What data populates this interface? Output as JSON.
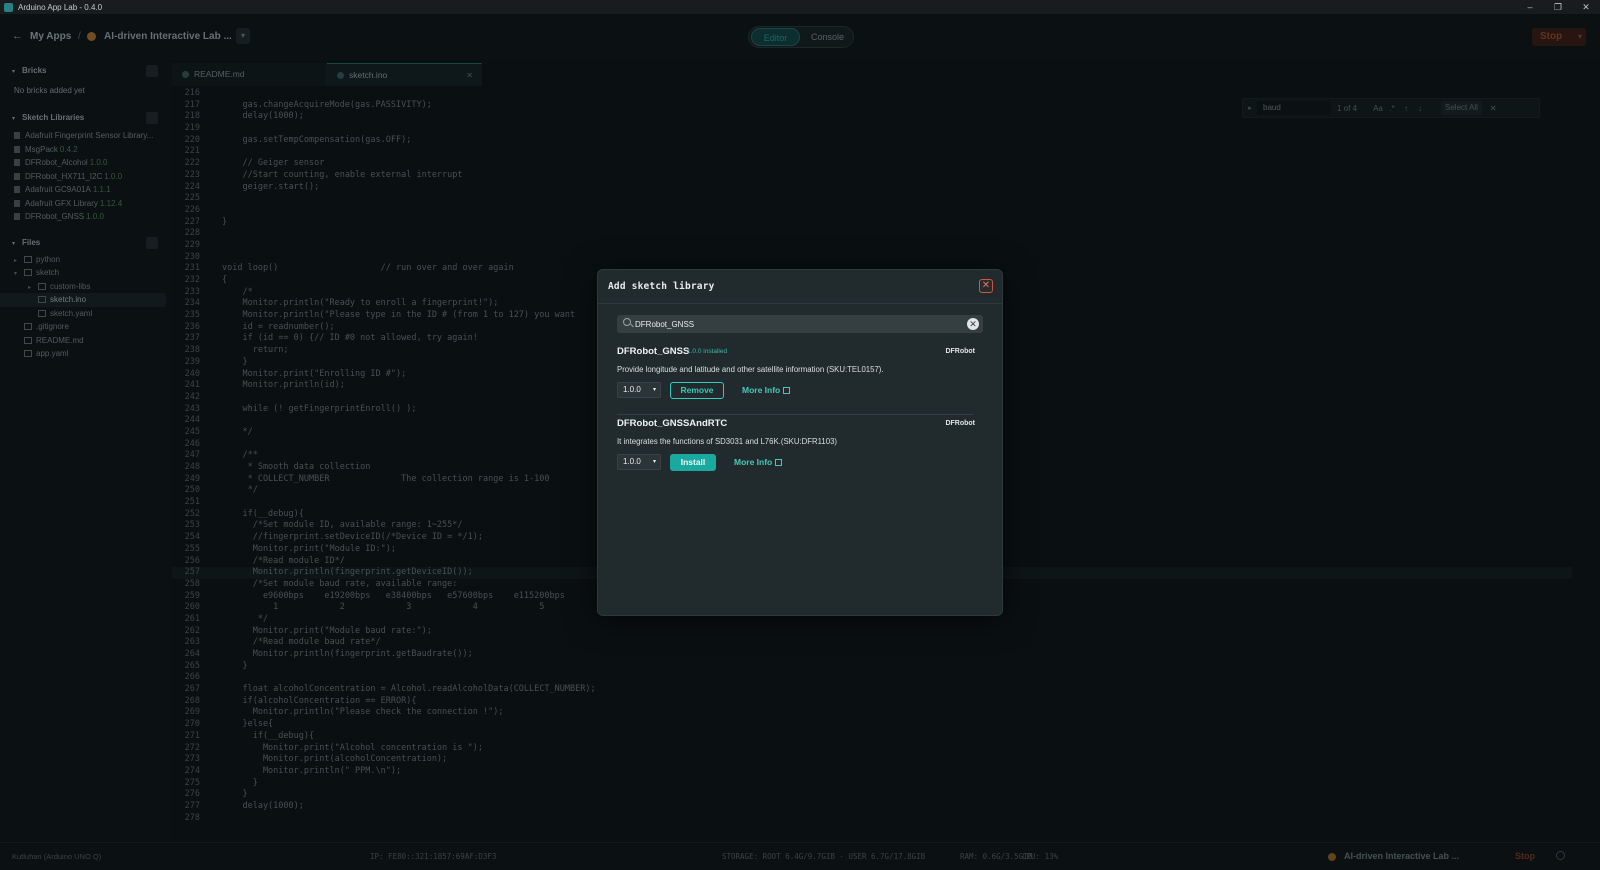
{
  "titlebar": {
    "title": "Arduino App Lab - 0.4.0",
    "minimize": "–",
    "maximize": "❐",
    "close": "✕"
  },
  "topbar": {
    "back": "←",
    "my_apps": "My Apps",
    "separator": "/",
    "app_name": "AI-driven Interactive Lab ...",
    "app_menu": "▾",
    "toggle": {
      "editor": "Editor",
      "console": "Console"
    },
    "stop": "Stop",
    "stop_caret": "▾"
  },
  "sidebar": {
    "bricks": {
      "title": "Bricks",
      "empty": "No bricks added yet"
    },
    "libraries": {
      "title": "Sketch Libraries",
      "items": [
        {
          "name": "Adafruit Fingerprint Sensor Library...",
          "version": ""
        },
        {
          "name": "MsgPack",
          "version": "0.4.2"
        },
        {
          "name": "DFRobot_Alcohol",
          "version": "1.0.0"
        },
        {
          "name": "DFRobot_HX711_I2C",
          "version": "1.0.0"
        },
        {
          "name": "Adafruit GC9A01A",
          "version": "1.1.1"
        },
        {
          "name": "Adafruit GFX Library",
          "version": "1.12.4"
        },
        {
          "name": "DFRobot_GNSS",
          "version": "1.0.0"
        }
      ]
    },
    "files": {
      "title": "Files",
      "items": [
        {
          "name": "python",
          "indent": 0,
          "arrow": "▸",
          "folder": true
        },
        {
          "name": "sketch",
          "indent": 0,
          "arrow": "▾",
          "folder": true
        },
        {
          "name": "custom-libs",
          "indent": 1,
          "arrow": "▸",
          "folder": true
        },
        {
          "name": "sketch.ino",
          "indent": 1,
          "arrow": "",
          "folder": false,
          "selected": true
        },
        {
          "name": "sketch.yaml",
          "indent": 1,
          "arrow": "",
          "folder": false
        },
        {
          "name": ".gitignore",
          "indent": 0,
          "arrow": "",
          "folder": false
        },
        {
          "name": "README.md",
          "indent": 0,
          "arrow": "",
          "folder": false
        },
        {
          "name": "app.yaml",
          "indent": 0,
          "arrow": "",
          "folder": false
        }
      ]
    }
  },
  "tabs": [
    {
      "label": "README.md",
      "active": false,
      "close": ""
    },
    {
      "label": "sketch.ino",
      "active": true,
      "close": "✕"
    }
  ],
  "findbar": {
    "value": "baud",
    "count": "1 of 4",
    "opt_case": "Aa",
    "opt_regex": ".*",
    "up": "↑",
    "down": "↓",
    "select_all": "Select All",
    "close": "✕"
  },
  "code_lines": [
    {
      "n": "216",
      "t": ""
    },
    {
      "n": "217",
      "t": "    gas.changeAcquireMode(gas.PASSIVITY);"
    },
    {
      "n": "218",
      "t": "    delay(1000);"
    },
    {
      "n": "219",
      "t": ""
    },
    {
      "n": "220",
      "t": "    gas.setTempCompensation(gas.OFF);"
    },
    {
      "n": "221",
      "t": ""
    },
    {
      "n": "222",
      "t": "    // Geiger sensor"
    },
    {
      "n": "223",
      "t": "    //Start counting, enable external interrupt"
    },
    {
      "n": "224",
      "t": "    geiger.start();"
    },
    {
      "n": "225",
      "t": ""
    },
    {
      "n": "226",
      "t": ""
    },
    {
      "n": "227",
      "t": "}"
    },
    {
      "n": "228",
      "t": ""
    },
    {
      "n": "229",
      "t": ""
    },
    {
      "n": "230",
      "t": ""
    },
    {
      "n": "231",
      "t": "void loop()                    // run over and over again"
    },
    {
      "n": "232",
      "t": "{"
    },
    {
      "n": "233",
      "t": "    /*"
    },
    {
      "n": "234",
      "t": "    Monitor.println(\"Ready to enroll a fingerprint!\");"
    },
    {
      "n": "235",
      "t": "    Monitor.println(\"Please type in the ID # (from 1 to 127) you want"
    },
    {
      "n": "236",
      "t": "    id = readnumber();"
    },
    {
      "n": "237",
      "t": "    if (id == 0) {// ID #0 not allowed, try again!"
    },
    {
      "n": "238",
      "t": "      return;"
    },
    {
      "n": "239",
      "t": "    }"
    },
    {
      "n": "240",
      "t": "    Monitor.print(\"Enrolling ID #\");"
    },
    {
      "n": "241",
      "t": "    Monitor.println(id);"
    },
    {
      "n": "242",
      "t": ""
    },
    {
      "n": "243",
      "t": "    while (! getFingerprintEnroll() );"
    },
    {
      "n": "244",
      "t": ""
    },
    {
      "n": "245",
      "t": "    */"
    },
    {
      "n": "246",
      "t": ""
    },
    {
      "n": "247",
      "t": "    /**"
    },
    {
      "n": "248",
      "t": "     * Smooth data collection"
    },
    {
      "n": "249",
      "t": "     * COLLECT_NUMBER              The collection range is 1-100"
    },
    {
      "n": "250",
      "t": "     */"
    },
    {
      "n": "251",
      "t": ""
    },
    {
      "n": "252",
      "t": "    if(__debug){"
    },
    {
      "n": "253",
      "t": "      /*Set module ID, available range: 1~255*/"
    },
    {
      "n": "254",
      "t": "      //fingerprint.setDeviceID(/*Device ID = */1);"
    },
    {
      "n": "255",
      "t": "      Monitor.print(\"Module ID:\");"
    },
    {
      "n": "256",
      "t": "      /*Read module ID*/"
    },
    {
      "n": "257",
      "t": "      Monitor.println(fingerprint.getDeviceID());"
    },
    {
      "n": "258",
      "t": "      /*Set module baud rate, available range:"
    },
    {
      "n": "259",
      "t": "        e9600bps    e19200bps   e38400bps   e57600bps    e115200bps"
    },
    {
      "n": "260",
      "t": "          1            2            3            4            5"
    },
    {
      "n": "261",
      "t": "       */"
    },
    {
      "n": "262",
      "t": "      Monitor.print(\"Module baud rate:\");"
    },
    {
      "n": "263",
      "t": "      /*Read module baud rate*/"
    },
    {
      "n": "264",
      "t": "      Monitor.println(fingerprint.getBaudrate());"
    },
    {
      "n": "265",
      "t": "    }"
    },
    {
      "n": "266",
      "t": ""
    },
    {
      "n": "267",
      "t": "    float alcoholConcentration = Alcohol.readAlcoholData(COLLECT_NUMBER);"
    },
    {
      "n": "268",
      "t": "    if(alcoholConcentration == ERROR){"
    },
    {
      "n": "269",
      "t": "      Monitor.println(\"Please check the connection !\");"
    },
    {
      "n": "270",
      "t": "    }else{"
    },
    {
      "n": "271",
      "t": "      if(__debug){"
    },
    {
      "n": "272",
      "t": "        Monitor.print(\"Alcohol concentration is \");"
    },
    {
      "n": "273",
      "t": "        Monitor.print(alcoholConcentration);"
    },
    {
      "n": "274",
      "t": "        Monitor.println(\" PPM.\\n\");"
    },
    {
      "n": "275",
      "t": "      }"
    },
    {
      "n": "276",
      "t": "    }"
    },
    {
      "n": "277",
      "t": "    delay(1000);"
    },
    {
      "n": "278",
      "t": ""
    }
  ],
  "statusbar": {
    "board": "Kutluhan (Arduino UNO Q)",
    "ip": "IP: FE80::321:1857:69AF:D3F3",
    "storage": "STORAGE: ROOT 6.4G/9.7GIB · USER 6.7G/17.8GIB",
    "ram": "RAM: 0.6G/3.5GIB",
    "cpu": "CPU: 13%",
    "app_name": "AI-driven Interactive Lab ...",
    "stop": "Stop"
  },
  "modal": {
    "title": "Add sketch library",
    "close": "✕",
    "search": {
      "value": "DFRobot_GNSS",
      "placeholder": "Search",
      "clear": "✕"
    },
    "results": [
      {
        "name": "DFRobot_GNSS",
        "installed": "1.0.0 installed",
        "author": "DFRobot",
        "description": "Provide longitude and latitude and other satellite information (SKU:TEL0157).",
        "version": "1.0.0",
        "action": "Remove",
        "more_info": "More Info"
      },
      {
        "name": "DFRobot_GNSSAndRTC",
        "installed": "",
        "author": "DFRobot",
        "description": "It integrates the functions of SD3031 and L76K.(SKU:DFR1103)",
        "version": "1.0.0",
        "action": "Install",
        "more_info": "More Info"
      }
    ]
  },
  "colors": {
    "accent": "#1aa99e",
    "modal_bg": "#212b2d",
    "app_bg": "#0c1214",
    "close_red": "#c85848"
  }
}
